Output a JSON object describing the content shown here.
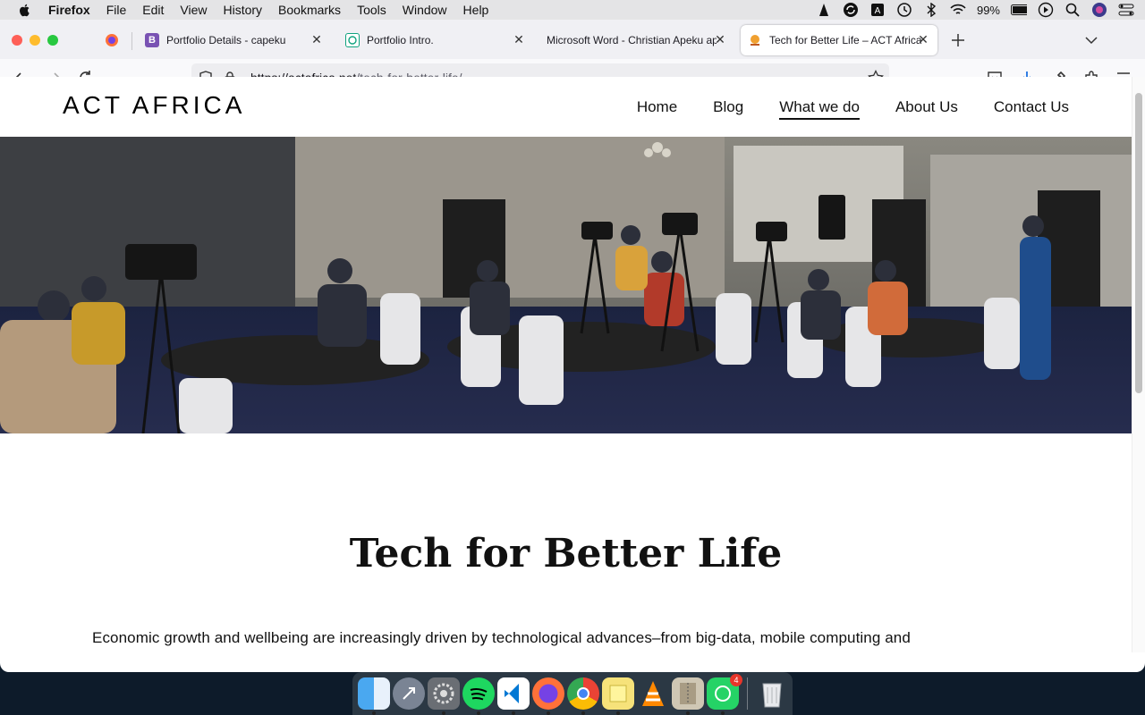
{
  "menubar": {
    "app_name": "Firefox",
    "items": [
      "File",
      "Edit",
      "View",
      "History",
      "Bookmarks",
      "Tools",
      "Window",
      "Help"
    ],
    "battery": "99%"
  },
  "browser": {
    "tabs": [
      {
        "title": "Portfolio Details - capeku",
        "icon": "bootstrap-icon",
        "color": "#7952b3",
        "glyph": "B"
      },
      {
        "title": "Portfolio Intro.",
        "icon": "chatgpt-icon",
        "color": "#10a37f",
        "glyph": ""
      },
      {
        "title": "Microsoft Word - Christian Apeku ap",
        "icon": "word-icon",
        "color": "",
        "glyph": ""
      },
      {
        "title": "Tech for Better Life – ACT Africa",
        "icon": "act-africa-icon",
        "color": "#f0a030",
        "glyph": ""
      }
    ],
    "url_host": "https://actafrica.net",
    "url_path": "/tech-for-better-life/"
  },
  "site": {
    "logo": "ACT AFRICA",
    "nav": [
      "Home",
      "Blog",
      "What we do",
      "About Us",
      "Contact Us"
    ],
    "active_nav": "What we do",
    "heading": "Tech for Better Life",
    "paragraph": "Economic growth and wellbeing are increasingly driven by technological advances–from big-data, mobile computing and"
  },
  "dock": {
    "apps": [
      "Finder",
      "Launchpad",
      "System Preferences",
      "Spotify",
      "Visual Studio Code",
      "Firefox",
      "Google Chrome",
      "Stickies",
      "VLC",
      "Archive Utility",
      "WhatsApp",
      "Trash"
    ],
    "whatsapp_badge": "4"
  },
  "colors": {
    "accent": "#0060df",
    "tabstrip": "#f0f0f4",
    "page_text": "#111111"
  }
}
